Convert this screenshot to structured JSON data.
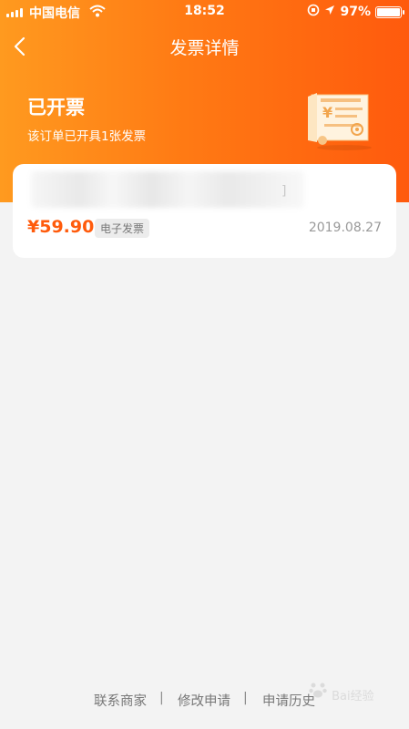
{
  "status_bar": {
    "carrier": "中国电信",
    "time": "18:52",
    "battery": "97%"
  },
  "nav": {
    "title": "发票详情"
  },
  "invoice_status": {
    "title": "已开票",
    "subtitle": "该订单已开具1张发票"
  },
  "card": {
    "shop_suffix": "]",
    "price": "¥59.90",
    "type_tag": "电子发票",
    "date": "2019.08.27"
  },
  "footer": {
    "links": [
      "联系商家",
      "修改申请",
      "申请历史"
    ],
    "separator": "|"
  },
  "watermark": "Bai经验",
  "colors": {
    "accent": "#ff5b0c",
    "header_start": "#ff9a1f",
    "header_end": "#ff5a0d",
    "background": "#f3f3f3"
  }
}
